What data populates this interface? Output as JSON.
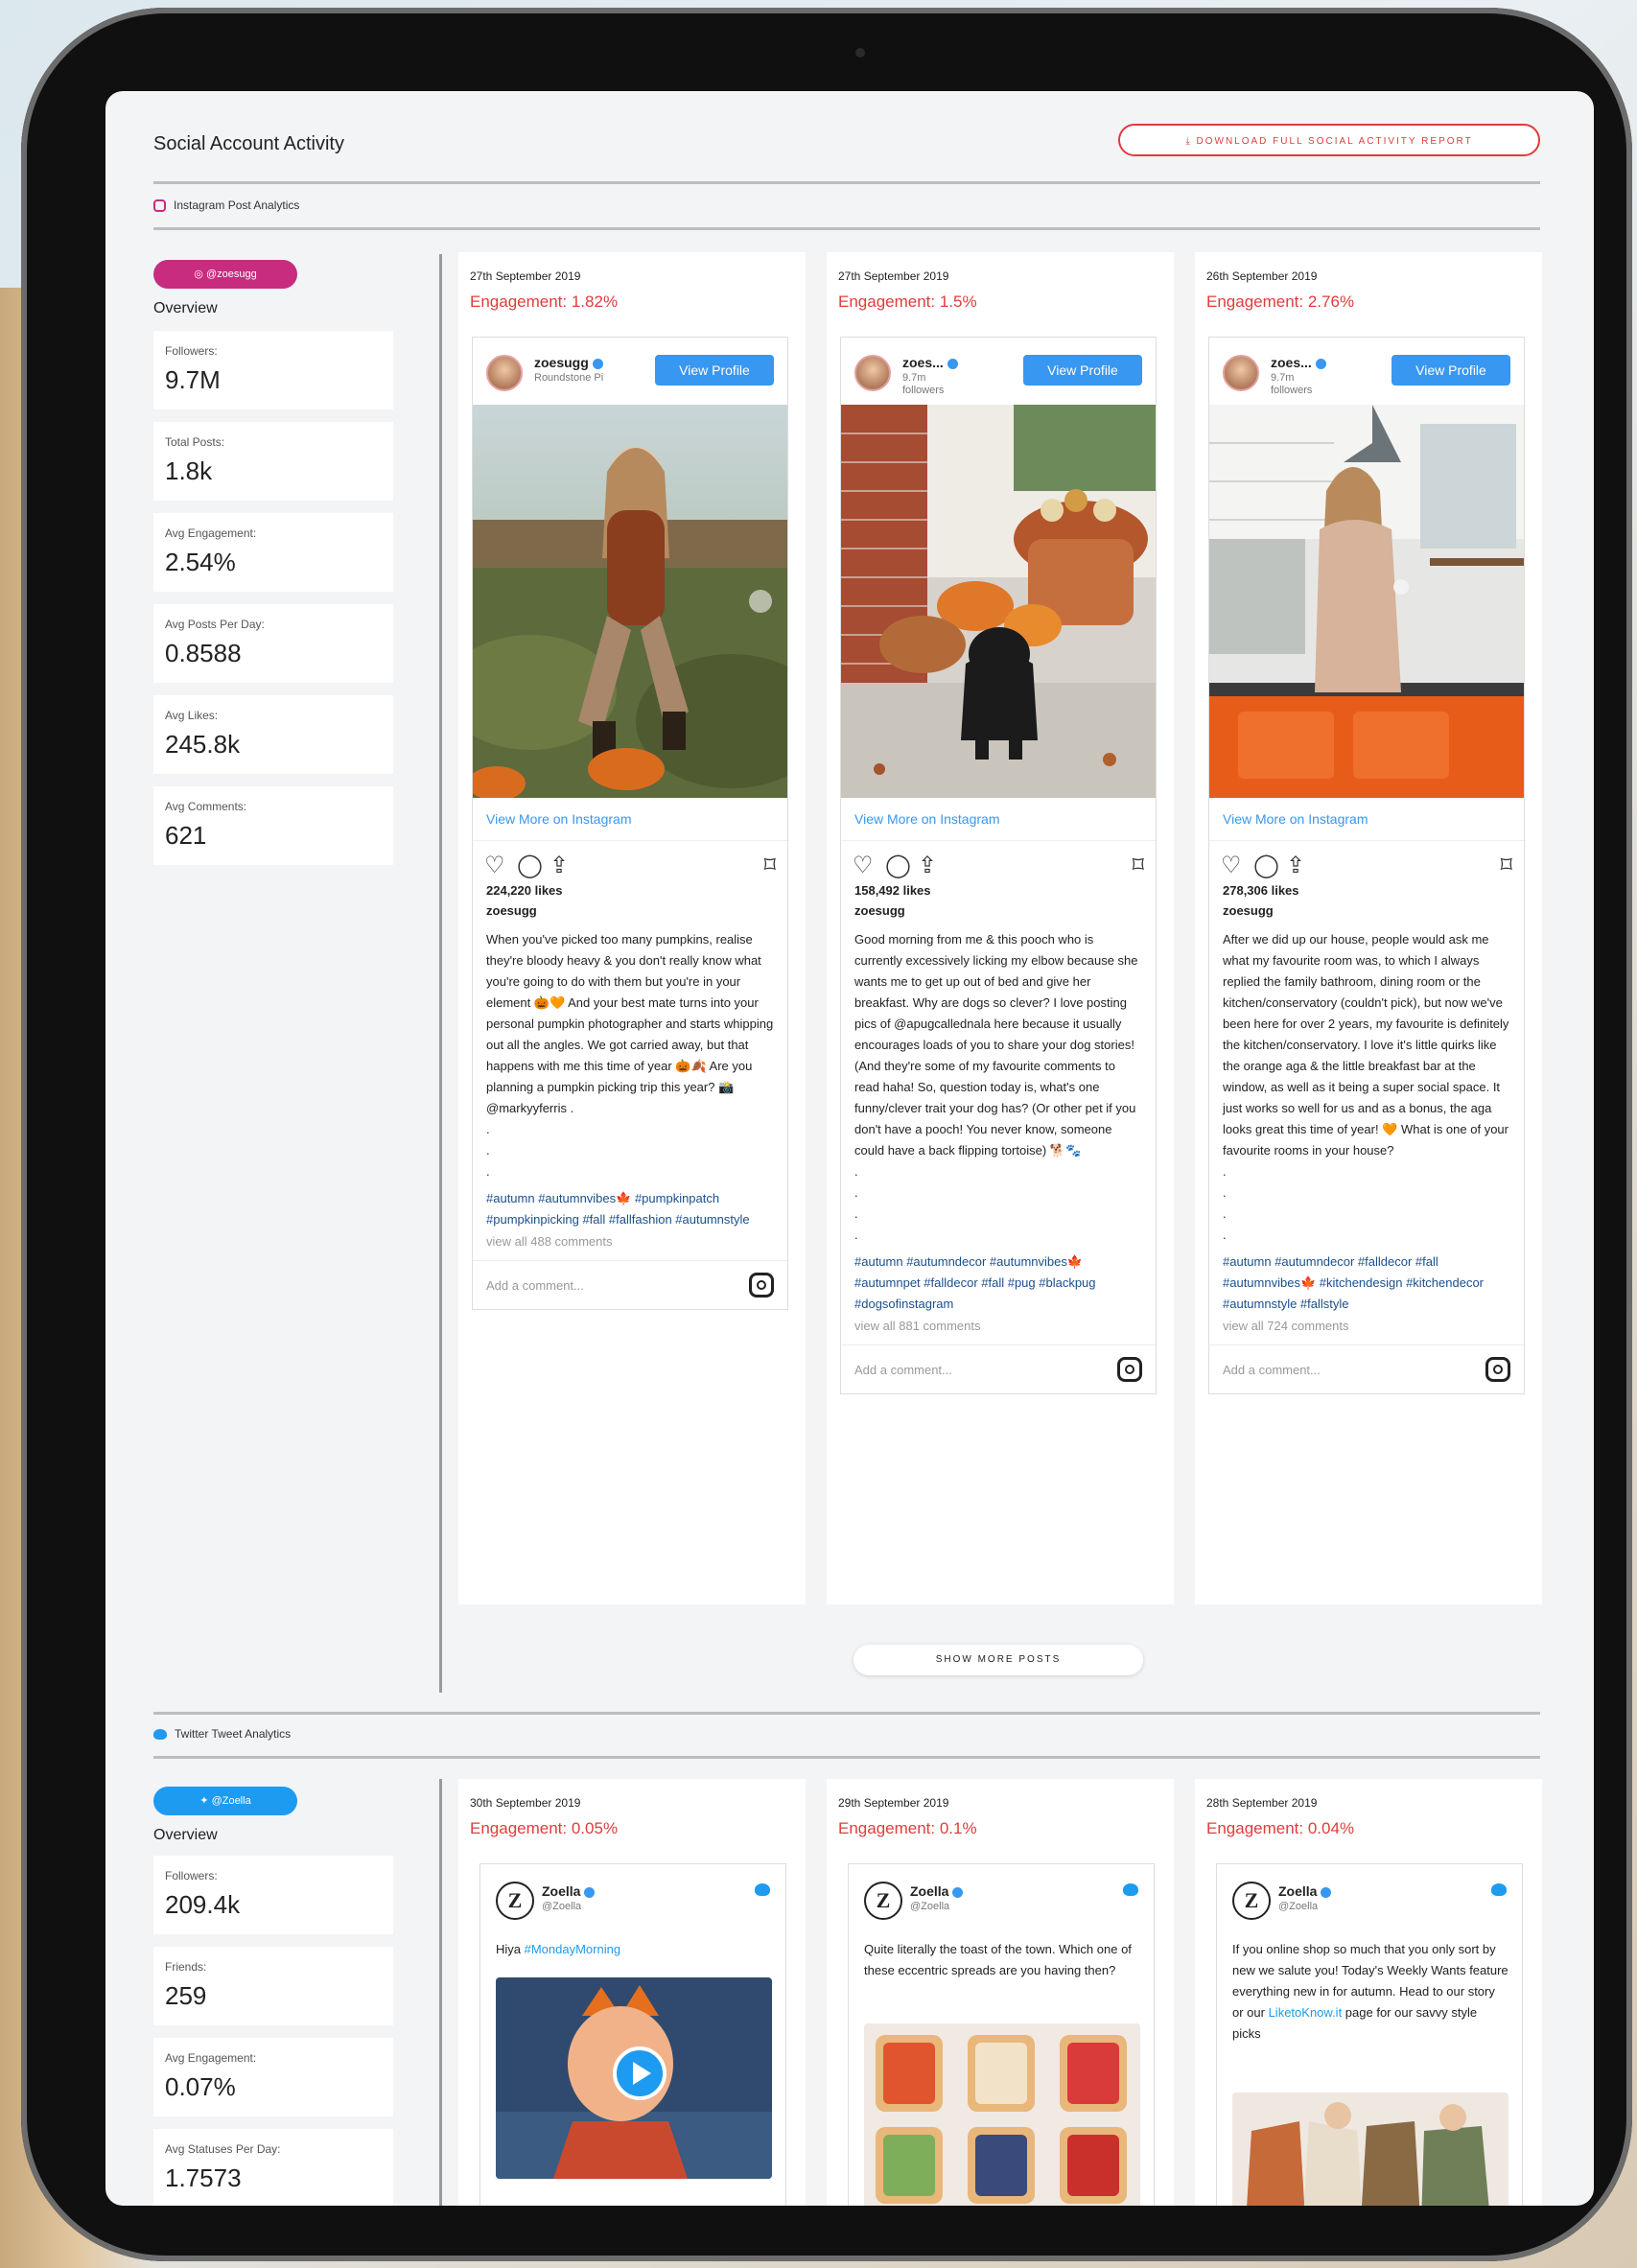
{
  "page": {
    "title": "Social Account Activity",
    "download_button": "DOWNLOAD FULL SOCIAL ACTIVITY REPORT",
    "instagram_section_label": "Instagram Post Analytics",
    "twitter_section_label": "Twitter Tweet Analytics",
    "show_more": "SHOW MORE POSTS"
  },
  "instagram": {
    "handle": "@zoesugg",
    "overview_label": "Overview",
    "stats": [
      {
        "label": "Followers:",
        "value": "9.7M"
      },
      {
        "label": "Total Posts:",
        "value": "1.8k"
      },
      {
        "label": "Avg Engagement:",
        "value": "2.54%"
      },
      {
        "label": "Avg Posts Per Day:",
        "value": "0.8588"
      },
      {
        "label": "Avg Likes:",
        "value": "245.8k"
      },
      {
        "label": "Avg Comments:",
        "value": "621"
      }
    ],
    "posts": [
      {
        "date": "27th September 2019",
        "engagement": "Engagement: 1.82%",
        "username": "zoesugg",
        "subtitle": "Roundstone Pi",
        "view_profile": "View Profile",
        "view_more": "View More on Instagram",
        "likes": "224,220 likes",
        "caption_user": "zoesugg",
        "caption": "When you've picked too many pumpkins, realise they're bloody heavy & you don't really know what you're going to do with them but you're in your element 🎃🧡 And your best mate turns into your personal pumpkin photographer and starts whipping out all the angles. We got carried away, but that happens with me this time of year 🎃🍂 Are you planning a pumpkin picking trip this year? 📸 @markyyferris .\n.\n.\n.",
        "hashtags": "#autumn #autumnvibes🍁 #pumpkinpatch #pumpkinpicking #fall #fallfashion #autumnstyle",
        "view_all": "view all 488 comments",
        "add_comment": "Add a comment..."
      },
      {
        "date": "27th September 2019",
        "engagement": "Engagement: 1.5%",
        "username": "zoes...",
        "subtitle": "9.7m\nfollowers",
        "view_profile": "View Profile",
        "view_more": "View More on Instagram",
        "likes": "158,492 likes",
        "caption_user": "zoesugg",
        "caption": "Good morning from me & this pooch who is currently excessively licking my elbow because she wants me to get up out of bed and give her breakfast. Why are dogs so clever? I love posting pics of @apugcallednala here because it usually encourages loads of you to share your dog stories! (And they're some of my favourite comments to read haha! So, question today is, what's one funny/clever trait your dog has? (Or other pet if you don't have a pooch! You never know, someone could have a back flipping tortoise) 🐕🐾\n.\n.\n.\n.",
        "hashtags": "#autumn #autumndecor #autumnvibes🍁 #autumnpet #falldecor #fall #pug #blackpug #dogsofinstagram",
        "view_all": "view all 881 comments",
        "add_comment": "Add a comment..."
      },
      {
        "date": "26th September 2019",
        "engagement": "Engagement: 2.76%",
        "username": "zoes...",
        "subtitle": "9.7m\nfollowers",
        "view_profile": "View Profile",
        "view_more": "View More on Instagram",
        "likes": "278,306 likes",
        "caption_user": "zoesugg",
        "caption": "After we did up our house, people would ask me what my favourite room was, to which I always replied the family bathroom, dining room or the kitchen/conservatory (couldn't pick), but now we've been here for over 2 years, my favourite is definitely the kitchen/conservatory. I love it's little quirks like the orange aga & the little breakfast bar at the window, as well as it being a super social space. It just works so well for us and as a bonus, the aga looks great this time of year! 🧡 What is one of your favourite rooms in your house?\n.\n.\n.\n.",
        "hashtags": "#autumn #autumndecor #falldecor #fall #autumnvibes🍁 #kitchendesign #kitchendecor #autumnstyle #fallstyle",
        "view_all": "view all 724 comments",
        "add_comment": "Add a comment..."
      }
    ]
  },
  "twitter": {
    "handle": "@Zoella",
    "overview_label": "Overview",
    "stats": [
      {
        "label": "Followers:",
        "value": "209.4k"
      },
      {
        "label": "Friends:",
        "value": "259"
      },
      {
        "label": "Avg Engagement:",
        "value": "0.07%"
      },
      {
        "label": "Avg Statuses Per Day:",
        "value": "1.7573"
      }
    ],
    "tweets": [
      {
        "date": "30th September 2019",
        "engagement": "Engagement: 0.05%",
        "name": "Zoella",
        "handle": "@Zoella",
        "text_plain": "Hiya ",
        "text_link": "#MondayMorning",
        "text_after": ""
      },
      {
        "date": "29th September 2019",
        "engagement": "Engagement: 0.1%",
        "name": "Zoella",
        "handle": "@Zoella",
        "text_plain": "Quite literally the toast of the town. Which one of these eccentric spreads are you having then?",
        "text_link": "",
        "text_after": ""
      },
      {
        "date": "28th September 2019",
        "engagement": "Engagement: 0.04%",
        "name": "Zoella",
        "handle": "@Zoella",
        "text_plain": "If you online shop so much that you only sort by new we salute you! Today's Weekly Wants feature everything new in for autumn. Head to our story or our ",
        "text_link": "LiketoKnow.it",
        "text_after": " page for our savvy style picks"
      }
    ]
  },
  "colors": {
    "accent_red": "#e03c3c",
    "instagram_pink": "#c72c7f",
    "twitter_blue": "#1d9bf0",
    "instagram_blue": "#3897f0"
  },
  "icons": {
    "heart": "heart-icon",
    "comment": "comment-icon",
    "share": "share-icon",
    "bookmark": "bookmark-icon",
    "instagram": "instagram-icon",
    "twitter": "twitter-bird-icon",
    "download": "download-icon",
    "verified": "verified-icon"
  }
}
